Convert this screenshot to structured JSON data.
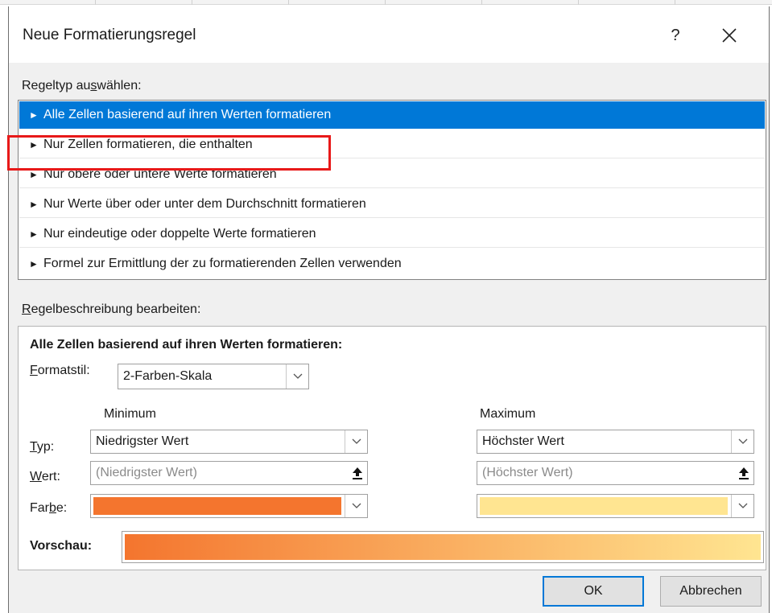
{
  "window": {
    "title": "Neue Formatierungsregel",
    "help_glyph": "?",
    "close_icon": "close-icon"
  },
  "rule_type": {
    "label_pre": "Regeltyp au",
    "label_accel": "s",
    "label_post": "wählen:",
    "items": [
      {
        "label": "Alle Zellen basierend auf ihren Werten formatieren",
        "selected": true
      },
      {
        "label": "Nur Zellen formatieren, die enthalten",
        "selected": false
      },
      {
        "label": "Nur obere oder untere Werte formatieren",
        "selected": false
      },
      {
        "label": "Nur Werte über oder unter dem Durchschnitt formatieren",
        "selected": false
      },
      {
        "label": "Nur eindeutige oder doppelte Werte formatieren",
        "selected": false
      },
      {
        "label": "Formel zur Ermittlung der zu formatierenden Zellen verwenden",
        "selected": false
      }
    ],
    "bullet": "►"
  },
  "description": {
    "label_accel": "R",
    "label_post": "egelbeschreibung bearbeiten:",
    "heading": "Alle Zellen basierend auf ihren Werten formatieren:",
    "format_style": {
      "label_accel": "F",
      "label_post": "ormatstil:",
      "value": "2-Farben-Skala"
    },
    "minimum_header": "Minimum",
    "maximum_header": "Maximum",
    "type_label_accel": "T",
    "type_label_post": "yp:",
    "value_label_accel": "W",
    "value_label_post": "ert:",
    "color_label_pre": "Far",
    "color_label_accel": "b",
    "color_label_post": "e:",
    "minimum": {
      "type": "Niedrigster Wert",
      "value_placeholder": "(Niedrigster Wert)",
      "color": "#f4752e"
    },
    "maximum": {
      "type": "Höchster Wert",
      "value_placeholder": "(Höchster Wert)",
      "color": "#ffe591"
    },
    "preview_label": "Vorschau:"
  },
  "buttons": {
    "ok": "OK",
    "cancel": "Abbrechen"
  },
  "colors": {
    "selection": "#0078d7",
    "highlight_box": "#e81919"
  }
}
